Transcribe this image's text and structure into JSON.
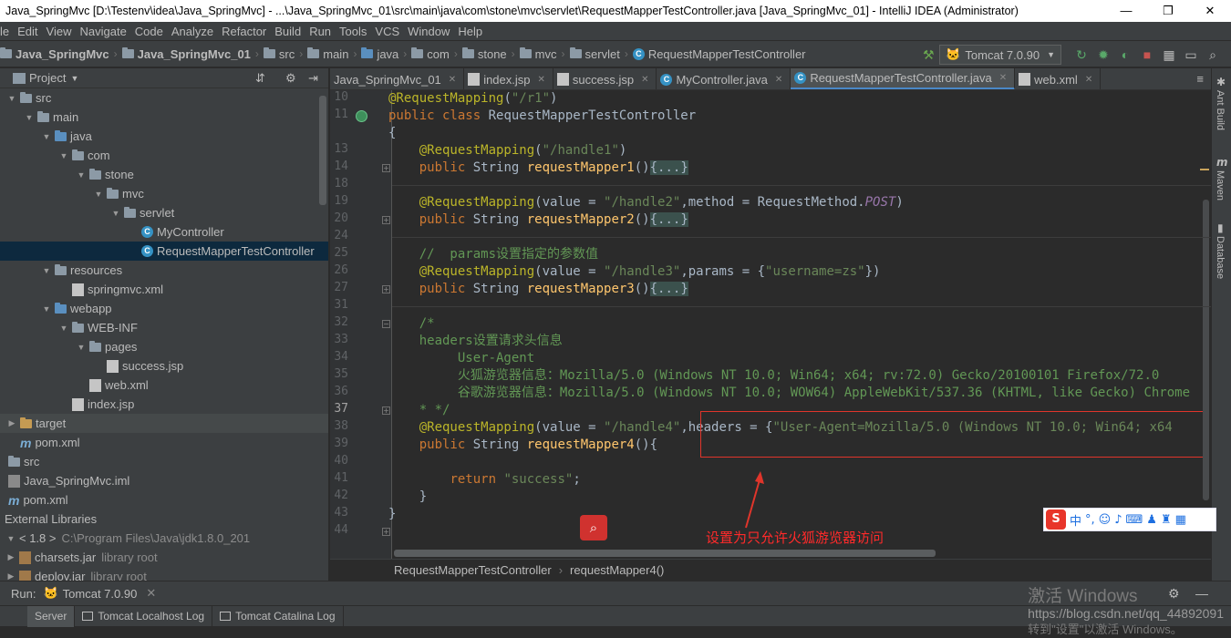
{
  "window": {
    "title": "Java_SpringMvc [D:\\Testenv\\idea\\Java_SpringMvc] - ...\\Java_SpringMvc_01\\src\\main\\java\\com\\stone\\mvc\\servlet\\RequestMapperTestController.java [Java_SpringMvc_01] - IntelliJ IDEA (Administrator)",
    "minimize": "—",
    "maximize": "❐",
    "close": "✕"
  },
  "menu": [
    "le",
    "Edit",
    "View",
    "Navigate",
    "Code",
    "Analyze",
    "Refactor",
    "Build",
    "Run",
    "Tools",
    "VCS",
    "Window",
    "Help"
  ],
  "breadcrumbs": [
    "Java_SpringMvc",
    "Java_SpringMvc_01",
    "src",
    "main",
    "java",
    "com",
    "stone",
    "mvc",
    "servlet",
    "RequestMapperTestController"
  ],
  "run_config": "Tomcat 7.0.90",
  "project_panel": {
    "title": "Project",
    "tree": [
      {
        "label": "src",
        "indent": 0,
        "type": "folder",
        "arrow": "▼"
      },
      {
        "label": "main",
        "indent": 1,
        "type": "folder",
        "arrow": "▼"
      },
      {
        "label": "java",
        "indent": 2,
        "type": "folder-blue",
        "arrow": "▼"
      },
      {
        "label": "com",
        "indent": 3,
        "type": "folder",
        "arrow": "▼"
      },
      {
        "label": "stone",
        "indent": 4,
        "type": "folder",
        "arrow": "▼"
      },
      {
        "label": "mvc",
        "indent": 5,
        "type": "folder",
        "arrow": "▼"
      },
      {
        "label": "servlet",
        "indent": 6,
        "type": "folder",
        "arrow": "▼"
      },
      {
        "label": "MyController",
        "indent": 7,
        "type": "class",
        "arrow": ""
      },
      {
        "label": "RequestMapperTestController",
        "indent": 7,
        "type": "class",
        "arrow": "",
        "selected": true
      },
      {
        "label": "resources",
        "indent": 2,
        "type": "folder",
        "arrow": "▼"
      },
      {
        "label": "springmvc.xml",
        "indent": 3,
        "type": "xml",
        "arrow": ""
      },
      {
        "label": "webapp",
        "indent": 2,
        "type": "folder-blue",
        "arrow": "▼"
      },
      {
        "label": "WEB-INF",
        "indent": 3,
        "type": "folder",
        "arrow": "▼"
      },
      {
        "label": "pages",
        "indent": 4,
        "type": "folder",
        "arrow": "▼"
      },
      {
        "label": "success.jsp",
        "indent": 5,
        "type": "jsp",
        "arrow": ""
      },
      {
        "label": "web.xml",
        "indent": 4,
        "type": "xml",
        "arrow": ""
      },
      {
        "label": "index.jsp",
        "indent": 3,
        "type": "jsp",
        "arrow": ""
      },
      {
        "label": "target",
        "indent": 0,
        "type": "folder-orange",
        "arrow": "▶",
        "highlight": true
      },
      {
        "label": "pom.xml",
        "indent": 0,
        "type": "maven",
        "arrow": ""
      },
      {
        "label": "src",
        "indent": -1,
        "type": "folder",
        "arrow": ""
      },
      {
        "label": "Java_SpringMvc.iml",
        "indent": -1,
        "type": "iml",
        "arrow": ""
      },
      {
        "label": "pom.xml",
        "indent": -1,
        "type": "maven",
        "arrow": ""
      },
      {
        "label": "External Libraries",
        "indent": -2,
        "type": "none",
        "arrow": ""
      },
      {
        "label": "< 1.8 >",
        "indent": -1,
        "type": "none",
        "arrow": "▼",
        "suffix": "C:\\Program Files\\Java\\jdk1.8.0_201"
      },
      {
        "label": "charsets.jar",
        "indent": -1,
        "type": "jar",
        "arrow": "▶",
        "suffix": "library root"
      },
      {
        "label": "deploy.jar",
        "indent": -1,
        "type": "jar",
        "arrow": "▶",
        "suffix": "library root"
      }
    ]
  },
  "tabs": [
    {
      "label": "Java_SpringMvc_01",
      "icon": "none",
      "active": false
    },
    {
      "label": "index.jsp",
      "icon": "jsp",
      "active": false
    },
    {
      "label": "success.jsp",
      "icon": "jsp",
      "active": false
    },
    {
      "label": "MyController.java",
      "icon": "class",
      "active": false
    },
    {
      "label": "RequestMapperTestController.java",
      "icon": "class",
      "active": true
    },
    {
      "label": "web.xml",
      "icon": "xml",
      "active": false
    }
  ],
  "code_lines": [
    {
      "n": "10",
      "html": "<span class='an'>@RequestMapping</span>(<span class='st'>\"/r1\"</span>)"
    },
    {
      "n": "11",
      "html": "<span class='kw'>public class</span> RequestMapperTestController"
    },
    {
      "n": "",
      "html": "{"
    },
    {
      "n": "13",
      "html": "    <span class='an'>@RequestMapping</span>(<span class='st'>\"/handle1\"</span>)"
    },
    {
      "n": "14",
      "html": "    <span class='kw'>public</span> String <span style='color:#ffc66d'>requestMapper1</span>()<span class='ef'>{...}</span>"
    },
    {
      "n": "18",
      "html": ""
    },
    {
      "n": "19",
      "html": "    <span class='an'>@RequestMapping</span>(value = <span class='st'>\"/handle2\"</span>,method = RequestMethod.<span class='it'>POST</span>)"
    },
    {
      "n": "20",
      "html": "    <span class='kw'>public</span> String <span style='color:#ffc66d'>requestMapper2</span>()<span class='ef'>{...}</span>"
    },
    {
      "n": "24",
      "html": ""
    },
    {
      "n": "25",
      "html": "    <span class='cm'>//  params设置指定的参数值</span>"
    },
    {
      "n": "26",
      "html": "    <span class='an'>@RequestMapping</span>(value = <span class='st'>\"/handle3\"</span>,params = {<span class='st'>\"username=zs\"</span>})"
    },
    {
      "n": "27",
      "html": "    <span class='kw'>public</span> String <span style='color:#ffc66d'>requestMapper3</span>()<span class='ef'>{...}</span>"
    },
    {
      "n": "31",
      "html": ""
    },
    {
      "n": "32",
      "html": "    <span class='cm'>/*</span>"
    },
    {
      "n": "33",
      "html": "    <span class='cm'>headers设置请求头信息</span>"
    },
    {
      "n": "34",
      "html": "         <span class='cm'>User-Agent</span>"
    },
    {
      "n": "35",
      "html": "         <span class='cm'>火狐游览器信息：Mozilla/5.0 (Windows NT 10.0; Win64; x64; rv:72.0) Gecko/20100101 Firefox/72.0</span>"
    },
    {
      "n": "36",
      "html": "         <span class='cm'>谷歌游览器信息：Mozilla/5.0 (Windows NT 10.0; WOW64) AppleWebKit/537.36 (KHTML, like Gecko) Chrome</span>"
    },
    {
      "n": "37",
      "html": "    <span class='cm'>* */</span>"
    },
    {
      "n": "38",
      "html": "    <span class='an'>@RequestMapping</span>(value = <span class='st'>\"/handle4\"</span>,headers = {<span class='st'>\"User-Agent=Mozilla/5.0 (Windows NT 10.0; Win64; x64</span>"
    },
    {
      "n": "39",
      "html": "    <span class='kw'>public</span> String <span style='color:#ffc66d'>requestMapper4</span>(){"
    },
    {
      "n": "40",
      "html": ""
    },
    {
      "n": "41",
      "html": "        <span class='kw'>return</span> <span class='st'>\"success\"</span>;"
    },
    {
      "n": "42",
      "html": "    }"
    },
    {
      "n": "43",
      "html": "}"
    },
    {
      "n": "44",
      "html": ""
    }
  ],
  "annotation": "设置为只允许火狐游览器访问",
  "editor_breadcrumb": [
    "RequestMapperTestController",
    "requestMapper4()"
  ],
  "right_tools": [
    "Ant Build",
    "Maven",
    "Database"
  ],
  "run": {
    "label": "Run:",
    "config": "Tomcat 7.0.90"
  },
  "bottom_tabs": [
    "Server",
    "Tomcat Localhost Log",
    "Tomcat Catalina Log"
  ],
  "watermark": {
    "line1": "激活 Windows",
    "line2": "https://blog.csdn.net/qq_44892091",
    "line3": "转到\"设置\"以激活 Windows。"
  },
  "ime": {
    "logo": "S",
    "lang": "中"
  }
}
